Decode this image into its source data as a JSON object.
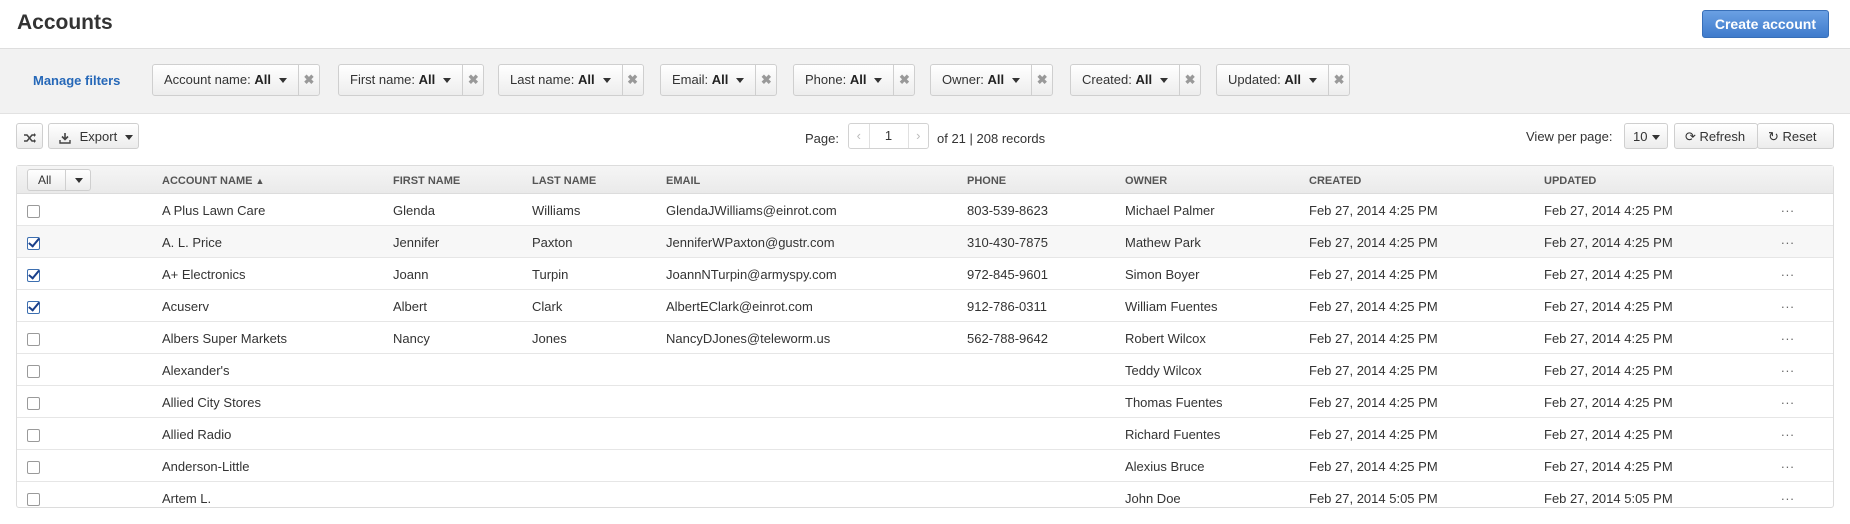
{
  "header": {
    "title": "Accounts",
    "create_label": "Create account"
  },
  "filters": {
    "manage_label": "Manage filters",
    "items": [
      {
        "label": "Account name:",
        "value": "All"
      },
      {
        "label": "First name:",
        "value": "All"
      },
      {
        "label": "Last name:",
        "value": "All"
      },
      {
        "label": "Email:",
        "value": "All"
      },
      {
        "label": "Phone:",
        "value": "All"
      },
      {
        "label": "Owner:",
        "value": "All"
      },
      {
        "label": "Created:",
        "value": "All"
      },
      {
        "label": "Updated:",
        "value": "All"
      }
    ],
    "remove_glyph": "✖"
  },
  "toolbar": {
    "export_label": "Export",
    "page_label": "Page:",
    "page_value": "1",
    "page_suffix": "of 21 | 208 records",
    "view_label": "View per page:",
    "per_page": "10",
    "refresh_label": "Refresh",
    "reset_label": "Reset"
  },
  "table": {
    "select_label": "All",
    "columns": [
      "Account Name",
      "First Name",
      "Last Name",
      "Email",
      "Phone",
      "Owner",
      "Created",
      "Updated"
    ],
    "sort_indicator": "▲",
    "rows": [
      {
        "checked": false,
        "account": "A Plus Lawn Care",
        "first": "Glenda",
        "last": "Williams",
        "email": "GlendaJWilliams@einrot.com",
        "phone": "803-539-8623",
        "owner": "Michael Palmer",
        "created": "Feb 27, 2014 4:25 PM",
        "updated": "Feb 27, 2014 4:25 PM",
        "more": "..."
      },
      {
        "checked": true,
        "account": "A. L. Price",
        "first": "Jennifer",
        "last": "Paxton",
        "email": "JenniferWPaxton@gustr.com",
        "phone": "310-430-7875",
        "owner": "Mathew Park",
        "created": "Feb 27, 2014 4:25 PM",
        "updated": "Feb 27, 2014 4:25 PM",
        "more": "..."
      },
      {
        "checked": true,
        "account": "A+ Electronics",
        "first": "Joann",
        "last": "Turpin",
        "email": "JoannNTurpin@armyspy.com",
        "phone": "972-845-9601",
        "owner": "Simon Boyer",
        "created": "Feb 27, 2014 4:25 PM",
        "updated": "Feb 27, 2014 4:25 PM",
        "more": "..."
      },
      {
        "checked": true,
        "account": "Acuserv",
        "first": "Albert",
        "last": "Clark",
        "email": "AlbertEClark@einrot.com",
        "phone": "912-786-0311",
        "owner": "William Fuentes",
        "created": "Feb 27, 2014 4:25 PM",
        "updated": "Feb 27, 2014 4:25 PM",
        "more": "..."
      },
      {
        "checked": false,
        "account": "Albers Super Markets",
        "first": "Nancy",
        "last": "Jones",
        "email": "NancyDJones@teleworm.us",
        "phone": "562-788-9642",
        "owner": "Robert Wilcox",
        "created": "Feb 27, 2014 4:25 PM",
        "updated": "Feb 27, 2014 4:25 PM",
        "more": "..."
      },
      {
        "checked": false,
        "account": "Alexander's",
        "first": "",
        "last": "",
        "email": "",
        "phone": "",
        "owner": "Teddy Wilcox",
        "created": "Feb 27, 2014 4:25 PM",
        "updated": "Feb 27, 2014 4:25 PM",
        "more": "..."
      },
      {
        "checked": false,
        "account": "Allied City Stores",
        "first": "",
        "last": "",
        "email": "",
        "phone": "",
        "owner": "Thomas Fuentes",
        "created": "Feb 27, 2014 4:25 PM",
        "updated": "Feb 27, 2014 4:25 PM",
        "more": "..."
      },
      {
        "checked": false,
        "account": "Allied Radio",
        "first": "",
        "last": "",
        "email": "",
        "phone": "",
        "owner": "Richard Fuentes",
        "created": "Feb 27, 2014 4:25 PM",
        "updated": "Feb 27, 2014 4:25 PM",
        "more": "..."
      },
      {
        "checked": false,
        "account": "Anderson-Little",
        "first": "",
        "last": "",
        "email": "",
        "phone": "",
        "owner": "Alexius Bruce",
        "created": "Feb 27, 2014 4:25 PM",
        "updated": "Feb 27, 2014 4:25 PM",
        "more": "..."
      },
      {
        "checked": false,
        "account": "Artem L.",
        "first": "",
        "last": "",
        "email": "",
        "phone": "",
        "owner": "John Doe",
        "created": "Feb 27, 2014 5:05 PM",
        "updated": "Feb 27, 2014 5:05 PM",
        "more": "..."
      }
    ]
  }
}
